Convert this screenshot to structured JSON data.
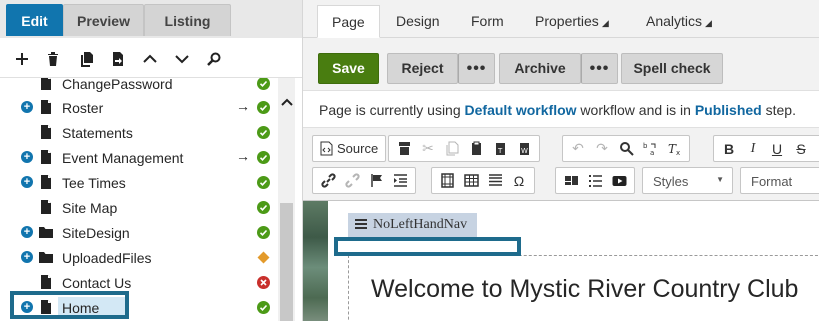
{
  "mode_tabs": [
    {
      "label": "Edit",
      "active": true
    },
    {
      "label": "Preview",
      "active": false
    },
    {
      "label": "Listing",
      "active": false
    }
  ],
  "tree_toolbar": [
    "add-icon",
    "delete-icon",
    "copy-icon",
    "move-icon",
    "move-up-icon",
    "move-down-icon",
    "search-icon"
  ],
  "tree": {
    "items": [
      {
        "label": "ChangePassword",
        "expandable": false,
        "type": "page",
        "status": "published",
        "arrow": false
      },
      {
        "label": "Roster",
        "expandable": true,
        "type": "page",
        "status": "published",
        "arrow": true
      },
      {
        "label": "Statements",
        "expandable": false,
        "type": "page",
        "status": "published",
        "arrow": false
      },
      {
        "label": "Event Management",
        "expandable": true,
        "type": "page",
        "status": "published",
        "arrow": true
      },
      {
        "label": "Tee Times",
        "expandable": true,
        "type": "page",
        "status": "published",
        "arrow": false
      },
      {
        "label": "Site Map",
        "expandable": false,
        "type": "page",
        "status": "published",
        "arrow": false
      },
      {
        "label": "SiteDesign",
        "expandable": true,
        "type": "folder",
        "status": "published",
        "arrow": false
      },
      {
        "label": "UploadedFiles",
        "expandable": true,
        "type": "folder",
        "status": "pending",
        "arrow": false
      },
      {
        "label": "Contact Us",
        "expandable": false,
        "type": "page",
        "status": "archived",
        "arrow": false
      },
      {
        "label": "Home",
        "expandable": true,
        "type": "page",
        "status": "published",
        "arrow": false,
        "selected": true
      }
    ]
  },
  "prop_tabs": [
    {
      "label": "Page",
      "active": true,
      "dropdown": false
    },
    {
      "label": "Design",
      "active": false,
      "dropdown": false
    },
    {
      "label": "Form",
      "active": false,
      "dropdown": false
    },
    {
      "label": "Properties",
      "active": false,
      "dropdown": true
    },
    {
      "label": "Analytics",
      "active": false,
      "dropdown": true
    }
  ],
  "actions": {
    "save": "Save",
    "reject": "Reject",
    "archive": "Archive",
    "spell_check": "Spell check",
    "more": "•••"
  },
  "workflow": {
    "prefix": "Page is currently using ",
    "workflow_name": "Default workflow",
    "middle": " workflow and is in ",
    "step_name": "Published",
    "suffix": " step."
  },
  "editor": {
    "source_label": "Source",
    "styles_label": "Styles",
    "format_label": "Format"
  },
  "content": {
    "zone_name": "NoLeftHandNav",
    "heading": "Welcome to Mystic River Country Club"
  },
  "colors": {
    "accent": "#1175ae",
    "save": "#497d10",
    "published": "#4c9a17",
    "pending": "#e39a2b",
    "archived": "#c9302c",
    "highlight": "#1e6b8c"
  }
}
